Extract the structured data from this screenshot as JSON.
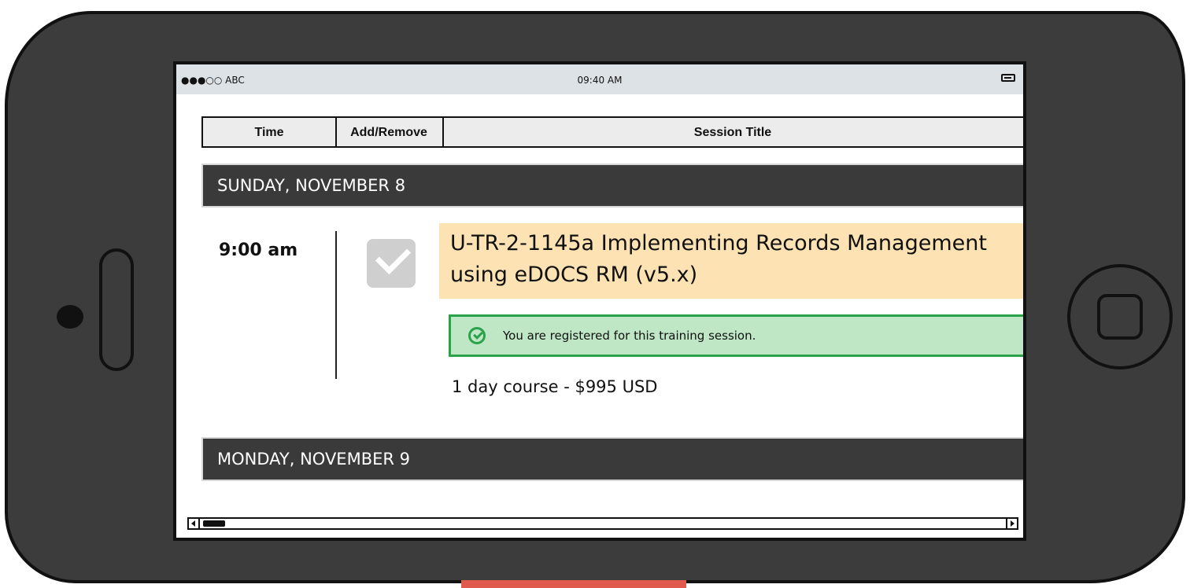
{
  "status_bar": {
    "carrier": "●●●○○ ABC",
    "time": "09:40 AM"
  },
  "table_header": {
    "time": "Time",
    "add_remove": "Add/Remove",
    "session_title": "Session Title"
  },
  "days": [
    {
      "label": "SUNDAY, NOVEMBER 8",
      "session": {
        "time": "9:00 am",
        "checked": true,
        "title": "U-TR-2-1145a Implementing Records Management using eDOCS RM (v5.x)",
        "notice": "You are registered for this training session.",
        "price": "1 day course - $995 USD"
      }
    },
    {
      "label": "MONDAY, NOVEMBER 9"
    }
  ],
  "colors": {
    "title_bg": "#fde3b4",
    "notice_bg": "#bfe7c6",
    "notice_border": "#2aa24a",
    "day_bg": "#3a3a3a"
  }
}
